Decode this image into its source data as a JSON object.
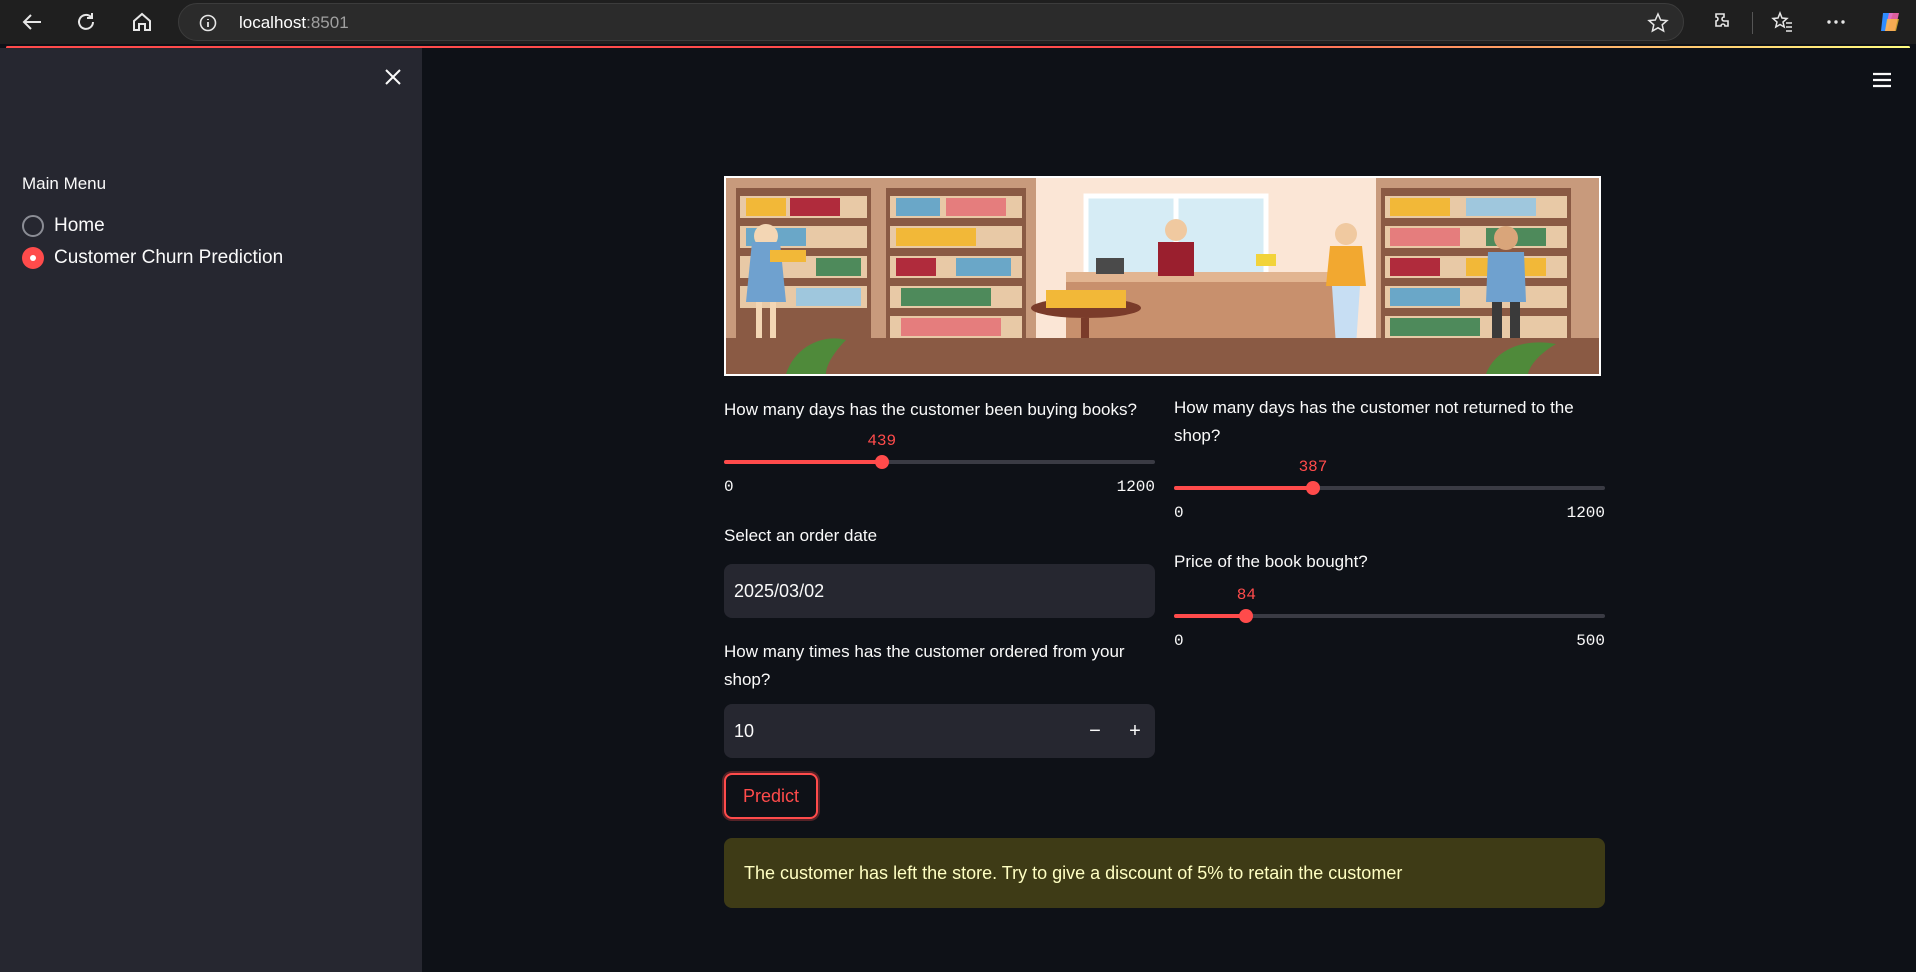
{
  "browser": {
    "url_host": "localhost",
    "url_port": ":8501"
  },
  "sidebar": {
    "menu_title": "Main Menu",
    "items": [
      {
        "label": "Home",
        "selected": false
      },
      {
        "label": "Customer Churn Prediction",
        "selected": true
      }
    ]
  },
  "form": {
    "days_buying": {
      "label": "How many days has the customer been buying books?",
      "value": "439",
      "min": "0",
      "max": "1200",
      "fraction": 0.366
    },
    "days_not_returned": {
      "label": "How many days has the customer not returned to the shop?",
      "value": "387",
      "min": "0",
      "max": "1200",
      "fraction": 0.3225
    },
    "order_date": {
      "label": "Select an order date",
      "value": "2025/03/02"
    },
    "book_price": {
      "label": "Price of the book bought?",
      "value": "84",
      "min": "0",
      "max": "500",
      "fraction": 0.168
    },
    "order_count": {
      "label": "How many times has the customer ordered from your shop?",
      "value": "10",
      "minus": "−",
      "plus": "+"
    },
    "predict_label": "Predict"
  },
  "result": {
    "message": "The customer has left the store. Try to give a discount of 5% to retain the customer"
  },
  "colors": {
    "accent": "#ff4b4b",
    "sidebar_bg": "#262730",
    "main_bg": "#0e1117",
    "alert_bg": "#3e3b16",
    "alert_text": "#ffffc2"
  }
}
